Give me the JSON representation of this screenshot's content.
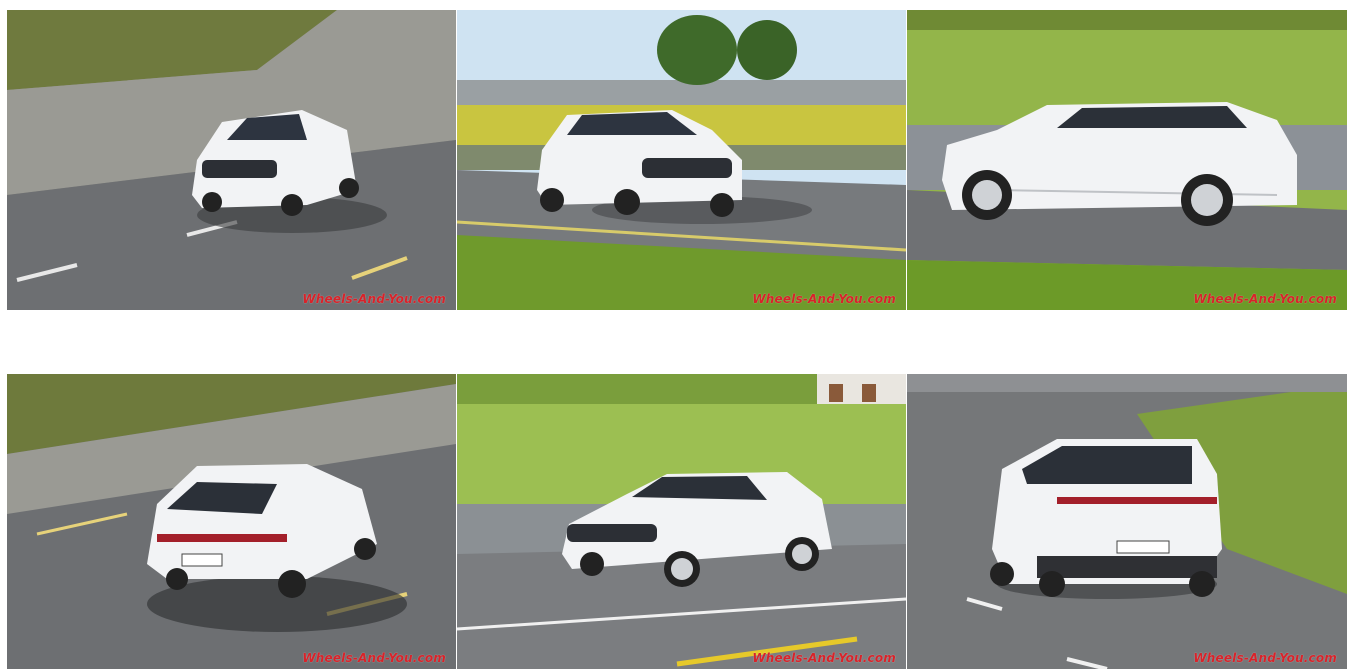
{
  "gallery": {
    "photos": [
      {
        "alt": "white suv driving downhill front",
        "watermark": "Wheels-And-You.com"
      },
      {
        "alt": "white suv front three quarter vineyard",
        "watermark": "Wheels-And-You.com"
      },
      {
        "alt": "white suv side profile motion blur",
        "watermark": "Wheels-And-You.com"
      },
      {
        "alt": "white suv rear top view",
        "watermark": "Wheels-And-You.com"
      },
      {
        "alt": "white suv front three quarter field",
        "watermark": "Wheels-And-You.com"
      },
      {
        "alt": "white suv rear driving curve",
        "watermark": "Wheels-And-You.com"
      }
    ]
  },
  "colors": {
    "watermark": "#d8232a",
    "car_body": "#f2f3f5",
    "road": "#6e7073",
    "grass": "#8bb23a"
  }
}
